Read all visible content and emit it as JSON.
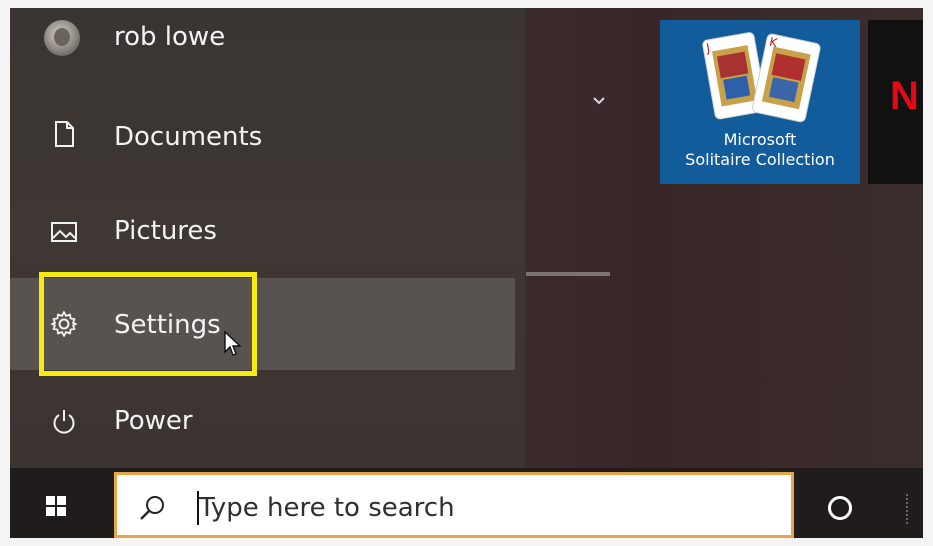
{
  "start_menu": {
    "user": {
      "name": "rob lowe"
    },
    "items": [
      {
        "label": "Documents",
        "icon": "document-icon"
      },
      {
        "label": "Pictures",
        "icon": "pictures-icon"
      },
      {
        "label": "Settings",
        "icon": "gear-icon",
        "highlighted": true
      },
      {
        "label": "Power",
        "icon": "power-icon"
      }
    ],
    "highlight_color": "#f5ea14"
  },
  "tiles": [
    {
      "label_line1": "Microsoft",
      "label_line2": "Solitaire Collection",
      "color": "#135c9b"
    },
    {
      "label": "N",
      "color": "#111111",
      "accent": "#e50914"
    }
  ],
  "taskbar": {
    "search": {
      "placeholder": "Type here to search",
      "border_color": "#e5a74a"
    }
  }
}
